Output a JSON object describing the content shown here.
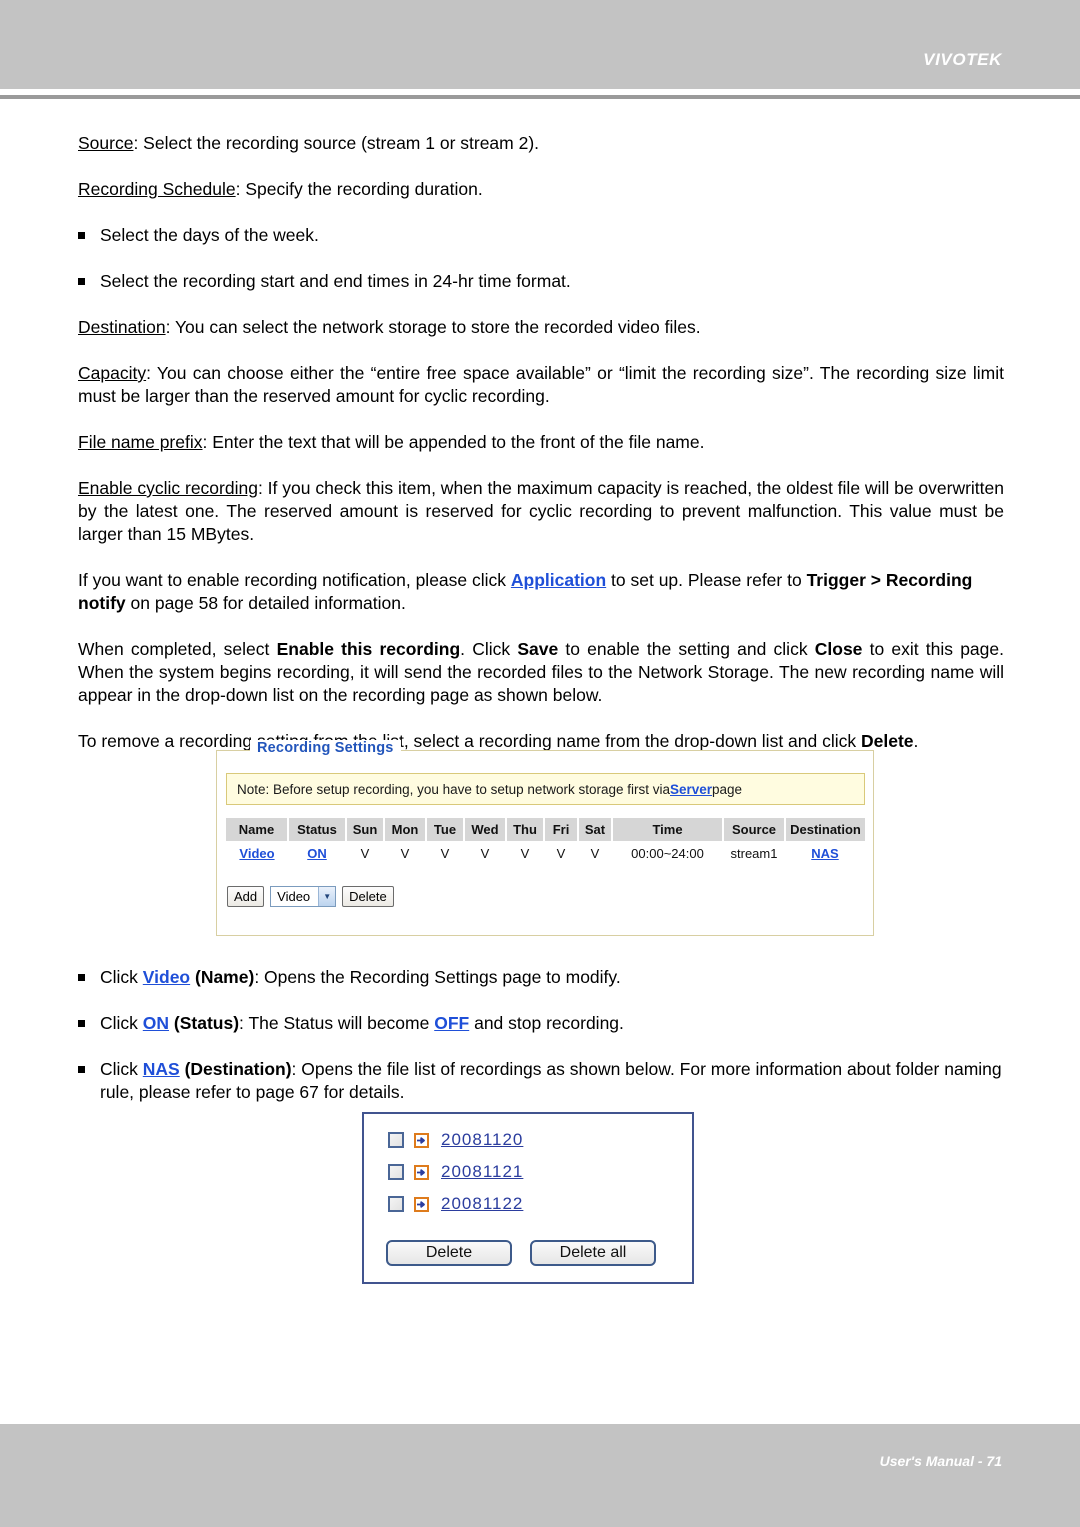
{
  "header": {
    "brand": "VIVOTEK"
  },
  "footer": {
    "text": "User's Manual - 71"
  },
  "body": {
    "p_source_label": "Source",
    "p_source_rest": ": Select the recording source (stream 1 or stream 2).",
    "p_schedule_label": "Recording Schedule",
    "p_schedule_rest": ": Specify the recording duration.",
    "bullet_days": "Select the days of the week.",
    "bullet_times": "Select the recording start and end times in 24-hr time format.",
    "p_destination_label": "Destination",
    "p_destination_rest": ": You can select the network storage to store the recorded video files.",
    "p_capacity_label": "Capacity",
    "p_capacity_rest": ": You can choose either the “entire free space available” or “limit the recording size”. The recording size limit must be larger than the reserved amount for cyclic recording.",
    "p_prefix_label": "File name prefix",
    "p_prefix_rest": ": Enter the text that will be appended to the front of the file name.",
    "p_cyclic_label": "Enable cyclic recording",
    "p_cyclic_rest": ": If you check this item, when the maximum capacity is reached, the oldest file will be overwritten by the latest one. The reserved amount is reserved for cyclic recording to prevent malfunction. This value must be larger than 15 MBytes.",
    "p_notify_1": "If you want to enable recording notification, please click ",
    "p_notify_link": "Application",
    "p_notify_2": " to set up. Please refer to ",
    "p_notify_bold1": "Trigger > Recording notify",
    "p_notify_3": " on page 58 for detailed information.",
    "p_complete_1": "When completed, select ",
    "p_complete_bold1": "Enable this recording",
    "p_complete_2": ". Click ",
    "p_complete_bold2": "Save",
    "p_complete_3": " to enable the setting and click ",
    "p_complete_bold3": "Close",
    "p_complete_4": " to exit this page. When the system begins recording, it will send the recorded files to the Network Storage. The new recording name will appear in the drop-down list on the recording page as shown below.",
    "p_remove_1": "To remove a recording setting from the list, select a recording name from the drop-down list and click ",
    "p_remove_bold": "Delete",
    "p_remove_2": ".",
    "bullet_click_video_1": "Click ",
    "bullet_click_video_link": "Video",
    "bullet_click_video_bold": " (Name)",
    "bullet_click_video_2": ": Opens the Recording Settings page to modify.",
    "bullet_click_on_1": "Click ",
    "bullet_click_on_link": "ON",
    "bullet_click_on_bold": " (Status)",
    "bullet_click_on_2": ": The Status will become ",
    "bullet_click_on_link2": "OFF",
    "bullet_click_on_3": " and stop recording.",
    "bullet_click_nas_1": "Click ",
    "bullet_click_nas_link": "NAS",
    "bullet_click_nas_bold": " (Destination)",
    "bullet_click_nas_2": ": Opens the file list of recordings as shown below. For more information about folder naming rule, please refer to page 67 for details."
  },
  "recording_settings": {
    "legend": "Recording Settings",
    "note_prefix": "Note: Before setup recording, you have to setup network storage first via ",
    "note_link": "Server",
    "note_suffix": " page",
    "table": {
      "headers": [
        "Name",
        "Status",
        "Sun",
        "Mon",
        "Tue",
        "Wed",
        "Thu",
        "Fri",
        "Sat",
        "Time",
        "Source",
        "Destination"
      ],
      "rows": [
        {
          "name": "Video",
          "status": "ON",
          "sun": "V",
          "mon": "V",
          "tue": "V",
          "wed": "V",
          "thu": "V",
          "fri": "V",
          "sat": "V",
          "time": "00:00~24:00",
          "source": "stream1",
          "destination": "NAS"
        }
      ]
    },
    "add_label": "Add",
    "select_value": "Video",
    "select_arrow": "▼",
    "delete_label": "Delete"
  },
  "file_list": {
    "files": [
      {
        "name": "20081120"
      },
      {
        "name": "20081121"
      },
      {
        "name": "20081122"
      }
    ],
    "delete_label": "Delete",
    "delete_all_label": "Delete all"
  },
  "colors": {
    "header_gray": "#c3c3c3",
    "link_blue": "#1f4fd8",
    "legend_blue": "#2255bb",
    "note_bg": "#fffce0",
    "note_border": "#d9c97a",
    "fieldset_border": "#d8cfa2",
    "box_border": "#41548f",
    "folder_orange": "#de7b1c"
  }
}
